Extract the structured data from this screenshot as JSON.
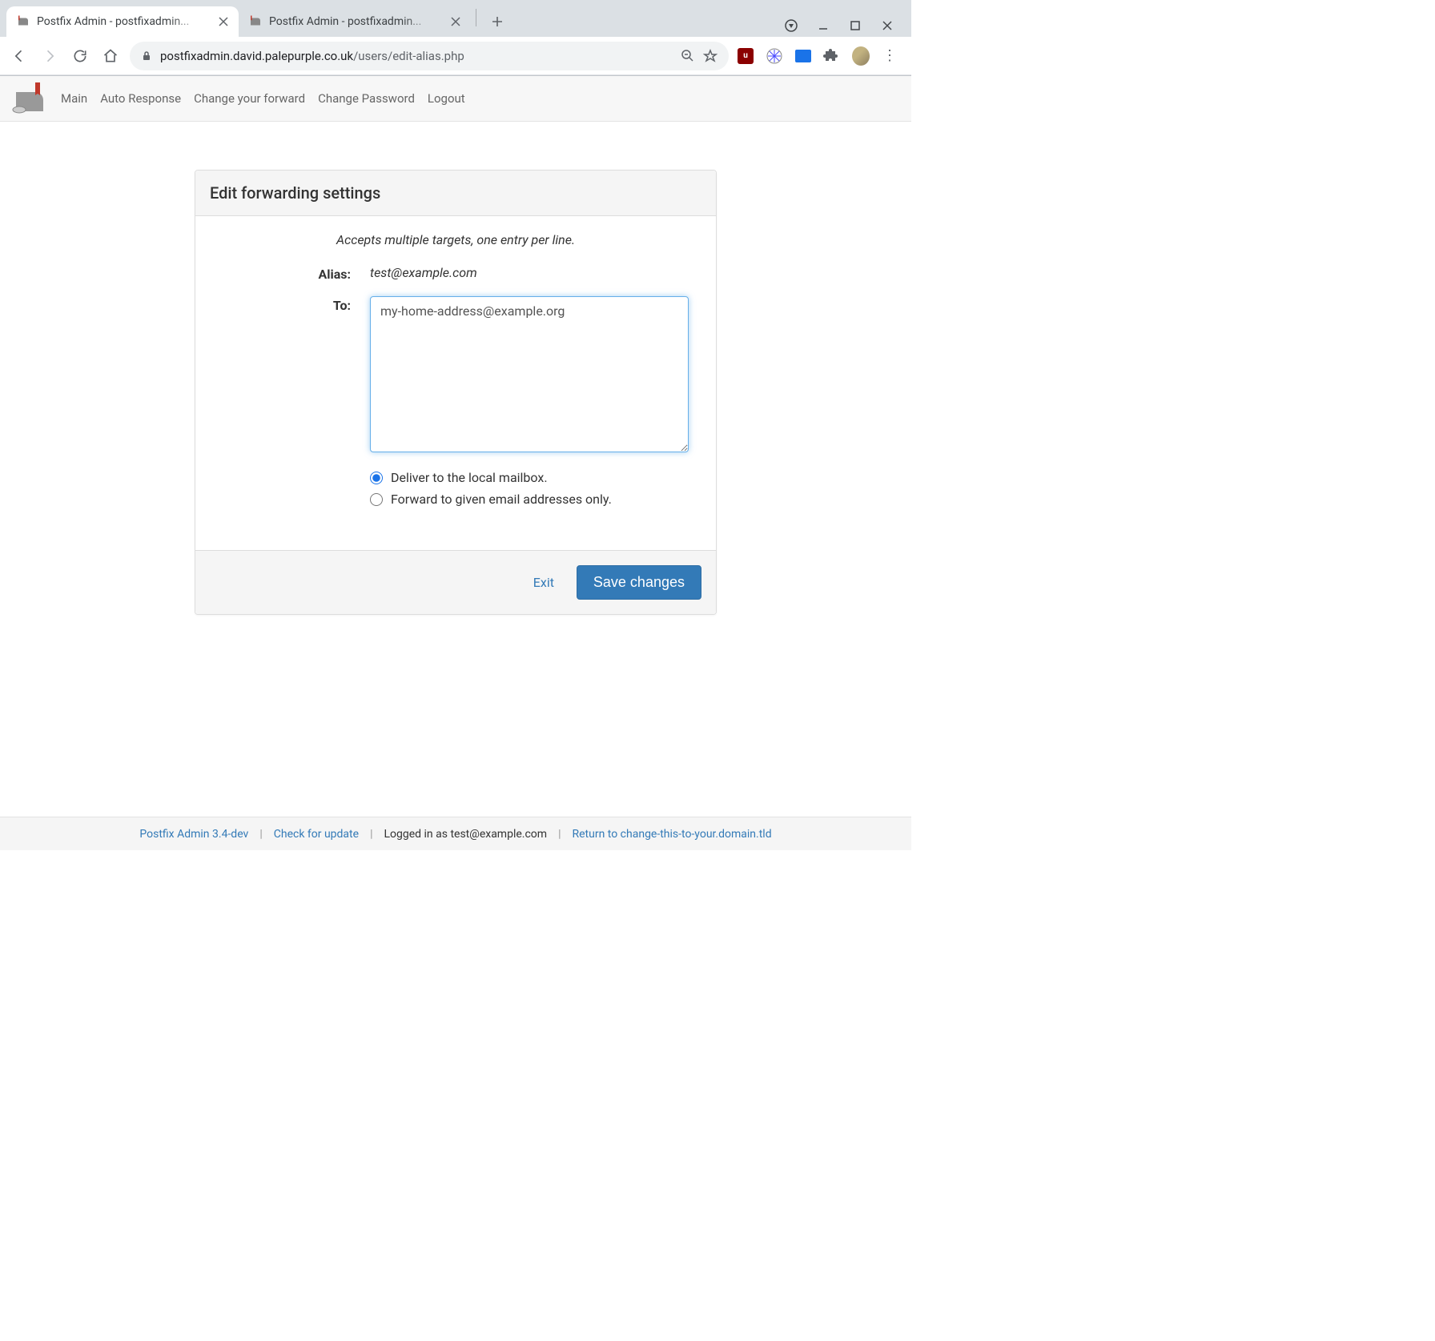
{
  "browser": {
    "tabs": [
      {
        "title": "Postfix Admin - postfixadmin..."
      },
      {
        "title": "Postfix Admin - postfixadmin..."
      }
    ],
    "url_host": "postfixadmin.david.palepurple.co.uk",
    "url_path": "/users/edit-alias.php"
  },
  "nav": {
    "items": [
      "Main",
      "Auto Response",
      "Change your forward",
      "Change Password",
      "Logout"
    ]
  },
  "panel": {
    "title": "Edit forwarding settings",
    "hint": "Accepts multiple targets, one entry per line.",
    "alias_label": "Alias:",
    "alias_value": "test@example.com",
    "to_label": "To:",
    "to_value": "my-home-address@example.org",
    "radio1": "Deliver to the local mailbox.",
    "radio2": "Forward to given email addresses only.",
    "exit": "Exit",
    "save": "Save changes"
  },
  "footer": {
    "version": "Postfix Admin 3.4-dev",
    "check": "Check for update",
    "loggedin": "Logged in as test@example.com",
    "returnlink": "Return to change-this-to-your.domain.tld"
  }
}
